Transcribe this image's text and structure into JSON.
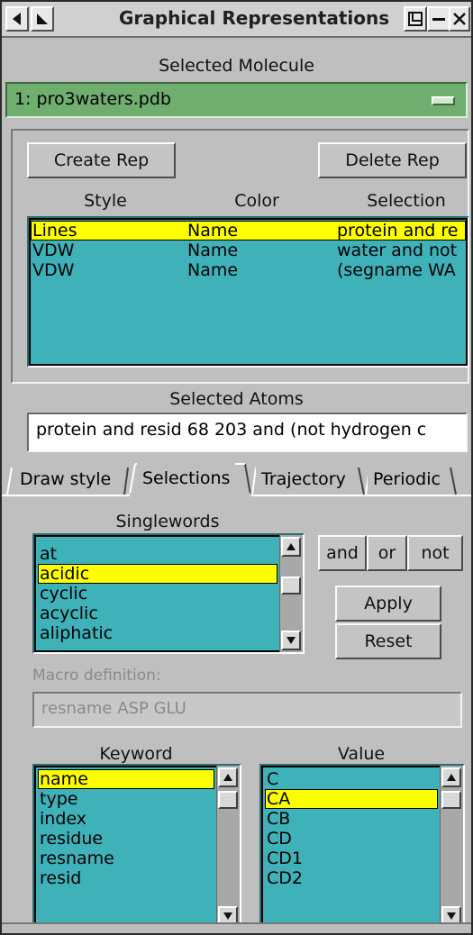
{
  "window": {
    "title": "Graphical Representations"
  },
  "molecule": {
    "label": "Selected Molecule",
    "value": "1: pro3waters.pdb"
  },
  "reps": {
    "create_label": "Create Rep",
    "delete_label": "Delete Rep",
    "columns": [
      "Style",
      "Color",
      "Selection"
    ],
    "rows": [
      {
        "style": "Lines",
        "color": "Name",
        "selection": "protein and re",
        "selected": true
      },
      {
        "style": "VDW",
        "color": "Name",
        "selection": "water and not",
        "selected": false
      },
      {
        "style": "VDW",
        "color": "Name",
        "selection": "(segname WA",
        "selected": false
      }
    ]
  },
  "atoms": {
    "label": "Selected Atoms",
    "value": "protein and resid 68 203 and (not hydrogen c"
  },
  "tabs": [
    {
      "label": "Draw style",
      "active": false
    },
    {
      "label": "Selections",
      "active": true
    },
    {
      "label": "Trajectory",
      "active": false
    },
    {
      "label": "Periodic",
      "active": false
    }
  ],
  "selections": {
    "singlewords_label": "Singlewords",
    "singlewords": [
      "at",
      "acidic",
      "cyclic",
      "acyclic",
      "aliphatic"
    ],
    "singlewords_selected": "acidic",
    "and_label": "and",
    "or_label": "or",
    "not_label": "not",
    "apply_label": "Apply",
    "reset_label": "Reset",
    "macro_label": "Macro definition:",
    "macro_value": "resname ASP GLU",
    "keyword_label": "Keyword",
    "keywords": [
      "name",
      "type",
      "index",
      "residue",
      "resname",
      "resid"
    ],
    "keyword_selected": "name",
    "value_label": "Value",
    "values": [
      "C",
      "CA",
      "CB",
      "CD",
      "CD1",
      "CD2"
    ],
    "value_selected": "CA"
  },
  "colors": {
    "list_bg": "#3fb1b9",
    "molecule_bg": "#6fae6f",
    "selection_highlight": "#ffff00"
  }
}
